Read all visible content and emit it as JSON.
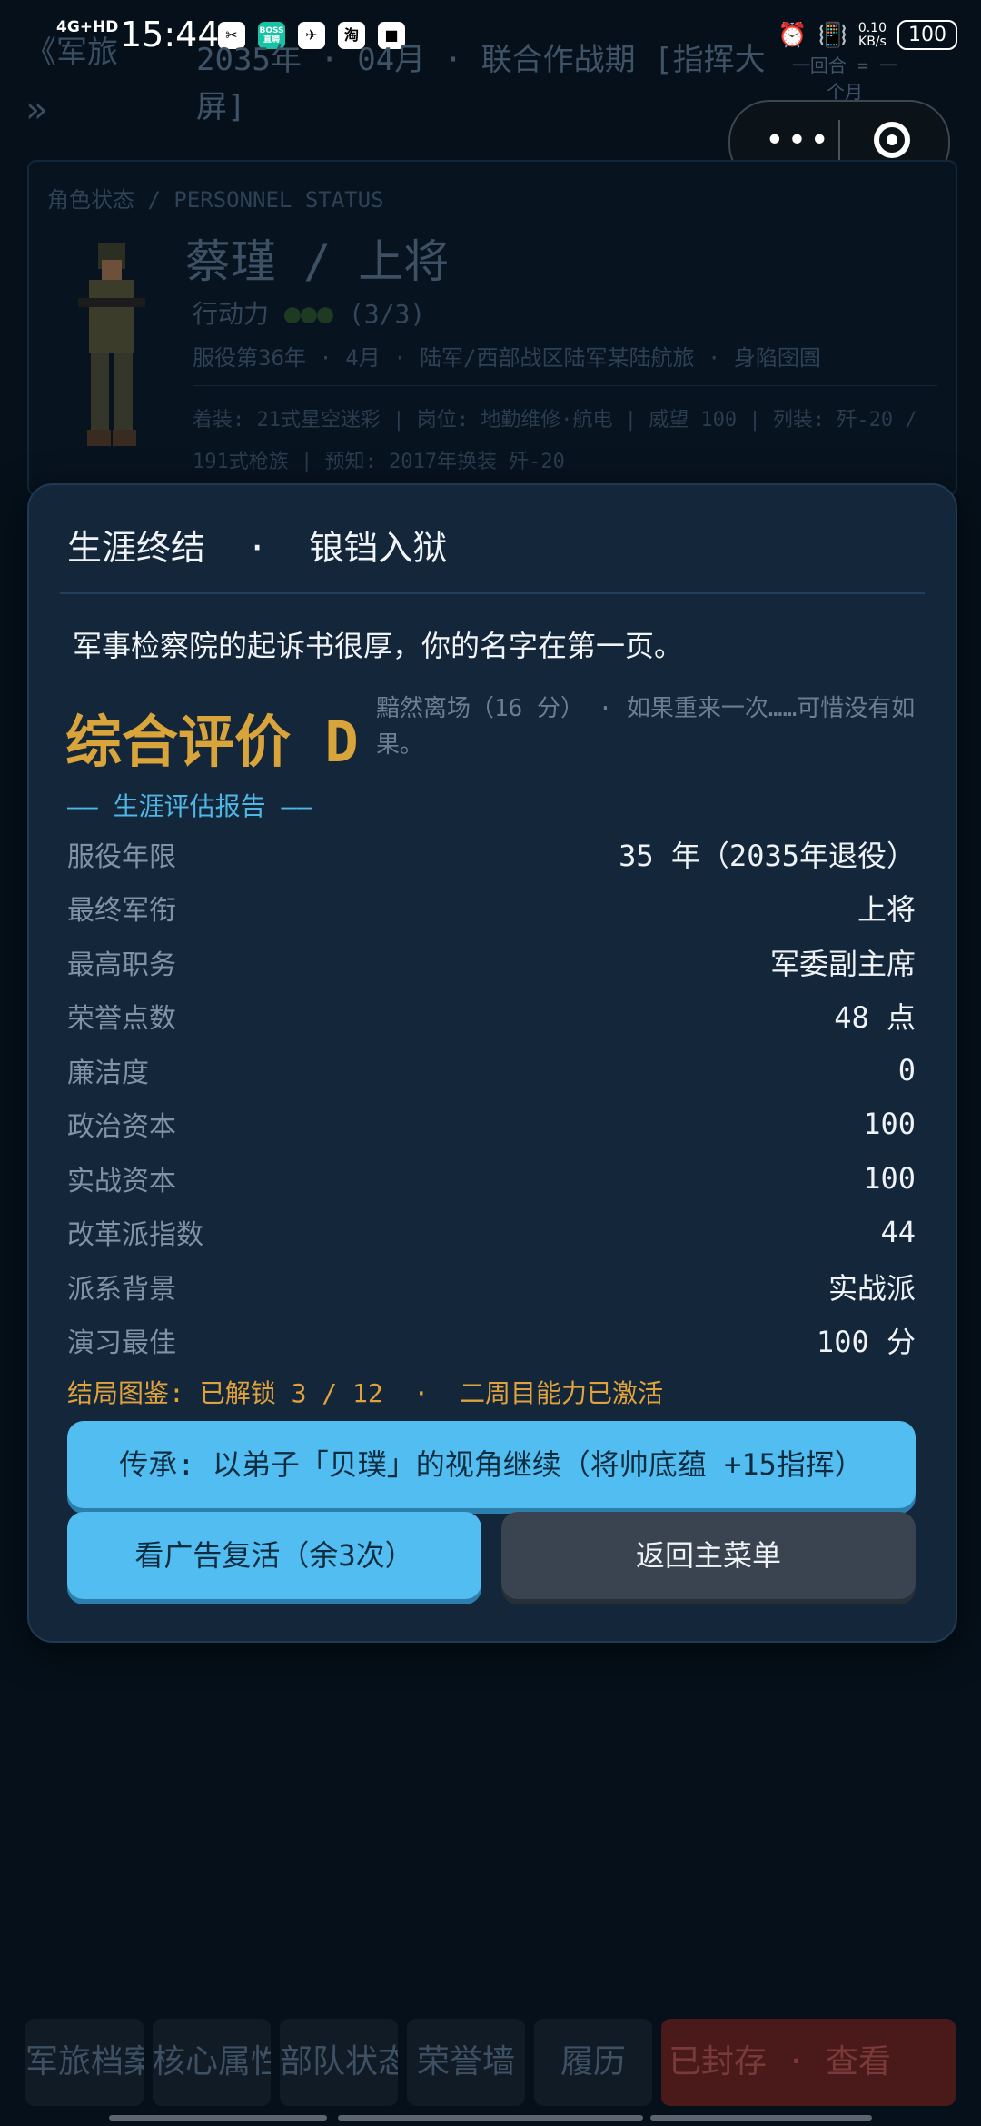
{
  "status_bar": {
    "network": "4G+HD",
    "time": "15:44",
    "apps": [
      "✂",
      "BOSS直聘",
      "✈",
      "淘",
      "■"
    ],
    "speed_value": "0.10",
    "speed_unit": "KB/s",
    "battery": "100"
  },
  "background": {
    "top_left": "《军旅",
    "header_title": "2035年 · 04月 · 联合作战期 [指挥大屏]",
    "round_label": "一回合 = 一个月",
    "personnel": {
      "section_title": "角色状态 / PERSONNEL STATUS",
      "name": "蔡瑾  /  上将",
      "action_label": "行动力",
      "action_value": "(3/3)",
      "service": "服役第36年 · 4月 · 陆军/西部战区陆军某陆航旅 · 身陷囹圄",
      "equipment": "着装: 21式星空迷彩 | 岗位: 地勤维修·航电 | 威望 100 | 列装: 歼-20 / 191式枪族 | 预知: 2017年换装 歼-20"
    }
  },
  "modal": {
    "title": "生涯终结  ·  锒铛入狱",
    "quote": "军事检察院的起诉书很厚，你的名字在第一页。",
    "grade_label": "综合评价 D",
    "grade_note": "黯然离场（16 分） · 如果重来一次……可惜没有如果。",
    "report_heading": "—— 生涯评估报告 ——",
    "stats": [
      {
        "label": "服役年限",
        "value": "35 年（2035年退役）"
      },
      {
        "label": "最终军衔",
        "value": "上将"
      },
      {
        "label": "最高职务",
        "value": "军委副主席"
      },
      {
        "label": "荣誉点数",
        "value": "48 点"
      },
      {
        "label": "廉洁度",
        "value": "0"
      },
      {
        "label": "政治资本",
        "value": "100"
      },
      {
        "label": "实战资本",
        "value": "100"
      },
      {
        "label": "改革派指数",
        "value": "44"
      },
      {
        "label": "派系背景",
        "value": "实战派"
      },
      {
        "label": "演习最佳",
        "value": "100 分"
      }
    ],
    "codex": "结局图鉴: 已解锁 3 / 12  ·  二周目能力已激活",
    "inherit_button": "传承: 以弟子「贝璞」的视角继续（将帅底蕴 +15指挥）",
    "revive_button": "看广告复活（余3次）",
    "menu_button": "返回主菜单"
  },
  "bottom_nav": {
    "tabs": [
      "军旅档案",
      "核心属性",
      "部队状态",
      "荣誉墙",
      "履历",
      "已封存  ·  查看"
    ]
  }
}
